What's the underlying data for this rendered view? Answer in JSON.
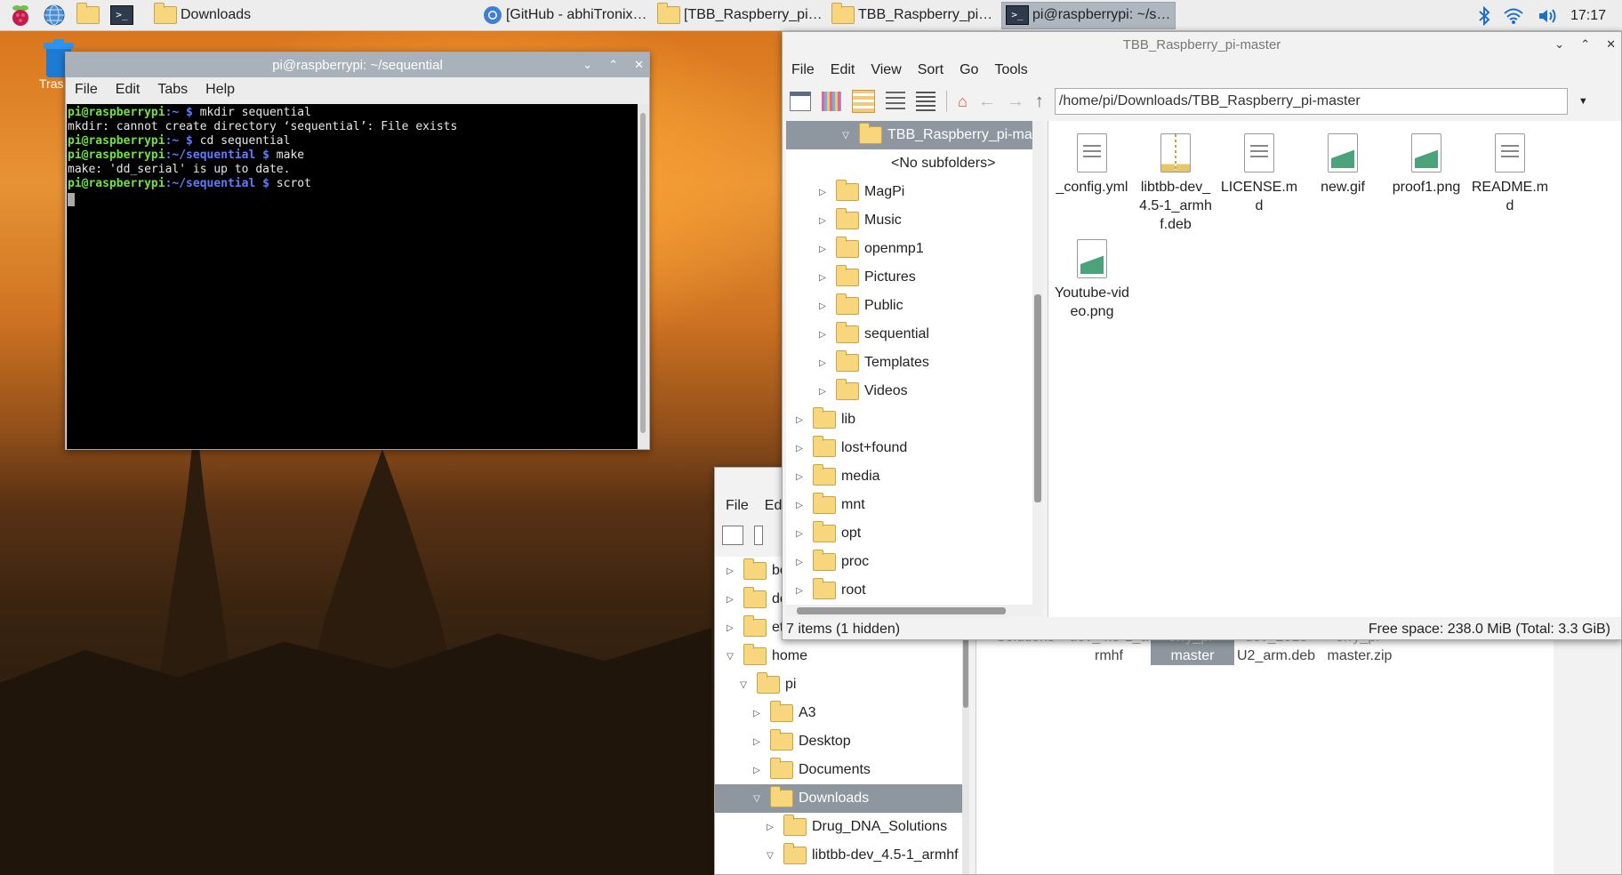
{
  "taskbar": {
    "items": [
      {
        "label": "Downloads"
      },
      {
        "label": "[GitHub - abhiTronix/..."
      },
      {
        "label": "[TBB_Raspberry_pi-m..."
      },
      {
        "label": "TBB_Raspberry_pi-m..."
      },
      {
        "label": "pi@raspberrypi: ~/se..."
      }
    ],
    "clock": "17:17"
  },
  "desktop": {
    "trash_label": "Tras"
  },
  "terminal": {
    "title": "pi@raspberrypi: ~/sequential",
    "menu": [
      "File",
      "Edit",
      "Tabs",
      "Help"
    ],
    "lines": [
      {
        "user": "pi@raspberrypi",
        "path": ":~ $",
        "cmd": " mkdir sequential"
      },
      {
        "out": "mkdir: cannot create directory ‘sequential’: File exists"
      },
      {
        "user": "pi@raspberrypi",
        "path": ":~ $",
        "cmd": " cd sequential"
      },
      {
        "user": "pi@raspberrypi",
        "path": ":~/sequential $",
        "cmd": " make"
      },
      {
        "out": "make: 'dd_serial' is up to date."
      },
      {
        "user": "pi@raspberrypi",
        "path": ":~/sequential $",
        "cmd": " scrot"
      }
    ]
  },
  "fm_front": {
    "title": "TBB_Raspberry_pi-master",
    "menu": [
      "File",
      "Edit",
      "View",
      "Sort",
      "Go",
      "Tools"
    ],
    "path": "/home/pi/Downloads/TBB_Raspberry_pi-master",
    "tree": [
      {
        "label": "TBB_Raspberry_pi-mast",
        "indent": 2,
        "arrow": "down",
        "selected": true
      },
      {
        "label": "<No subfolders>",
        "indent": 3,
        "arrow": "none"
      },
      {
        "label": "MagPi",
        "indent": 1,
        "arrow": "right"
      },
      {
        "label": "Music",
        "indent": 1,
        "arrow": "right"
      },
      {
        "label": "openmp1",
        "indent": 1,
        "arrow": "right"
      },
      {
        "label": "Pictures",
        "indent": 1,
        "arrow": "right"
      },
      {
        "label": "Public",
        "indent": 1,
        "arrow": "right"
      },
      {
        "label": "sequential",
        "indent": 1,
        "arrow": "right"
      },
      {
        "label": "Templates",
        "indent": 1,
        "arrow": "right"
      },
      {
        "label": "Videos",
        "indent": 1,
        "arrow": "right"
      },
      {
        "label": "lib",
        "indent": 0,
        "arrow": "right"
      },
      {
        "label": "lost+found",
        "indent": 0,
        "arrow": "right"
      },
      {
        "label": "media",
        "indent": 0,
        "arrow": "right"
      },
      {
        "label": "mnt",
        "indent": 0,
        "arrow": "right"
      },
      {
        "label": "opt",
        "indent": 0,
        "arrow": "right"
      },
      {
        "label": "proc",
        "indent": 0,
        "arrow": "right"
      },
      {
        "label": "root",
        "indent": 0,
        "arrow": "right"
      }
    ],
    "files": [
      {
        "name": "_config.yml",
        "kind": "text"
      },
      {
        "name": "libtbb-dev_4.5-1_armhf.deb",
        "kind": "zip"
      },
      {
        "name": "LICENSE.md",
        "kind": "text"
      },
      {
        "name": "new.gif",
        "kind": "img"
      },
      {
        "name": "proof1.png",
        "kind": "img"
      },
      {
        "name": "README.md",
        "kind": "text"
      },
      {
        "name": "Youtube-video.png",
        "kind": "img"
      }
    ],
    "status_left": "7 items (1 hidden)",
    "status_right": "Free space: 238.0 MiB (Total: 3.3 GiB)"
  },
  "fm_back": {
    "menu": [
      "File",
      "Edit"
    ],
    "tree": [
      {
        "label": "bo",
        "indent": 0,
        "arrow": "right"
      },
      {
        "label": "de",
        "indent": 0,
        "arrow": "right"
      },
      {
        "label": "et",
        "indent": 0,
        "arrow": "right"
      },
      {
        "label": "home",
        "indent": 0,
        "arrow": "down"
      },
      {
        "label": "pi",
        "indent": 1,
        "arrow": "down"
      },
      {
        "label": "A3",
        "indent": 2,
        "arrow": "right"
      },
      {
        "label": "Desktop",
        "indent": 2,
        "arrow": "right"
      },
      {
        "label": "Documents",
        "indent": 2,
        "arrow": "right"
      },
      {
        "label": "Downloads",
        "indent": 2,
        "arrow": "down",
        "selected": true
      },
      {
        "label": "Drug_DNA_Solutions",
        "indent": 3,
        "arrow": "right"
      },
      {
        "label": "libtbb-dev_4.5-1_armhf",
        "indent": 3,
        "arrow": "down"
      }
    ],
    "files_partial": [
      {
        "line1": "Solutions",
        "line2": ""
      },
      {
        "line1": "dev_4.5-1_a",
        "line2": "rmhf"
      },
      {
        "line1": "erry_pi-",
        "line2": "master"
      },
      {
        "line1": "dev_2018",
        "line2": "U2_arm.deb"
      },
      {
        "line1": "erry_pi-",
        "line2": "master.zip"
      }
    ]
  }
}
